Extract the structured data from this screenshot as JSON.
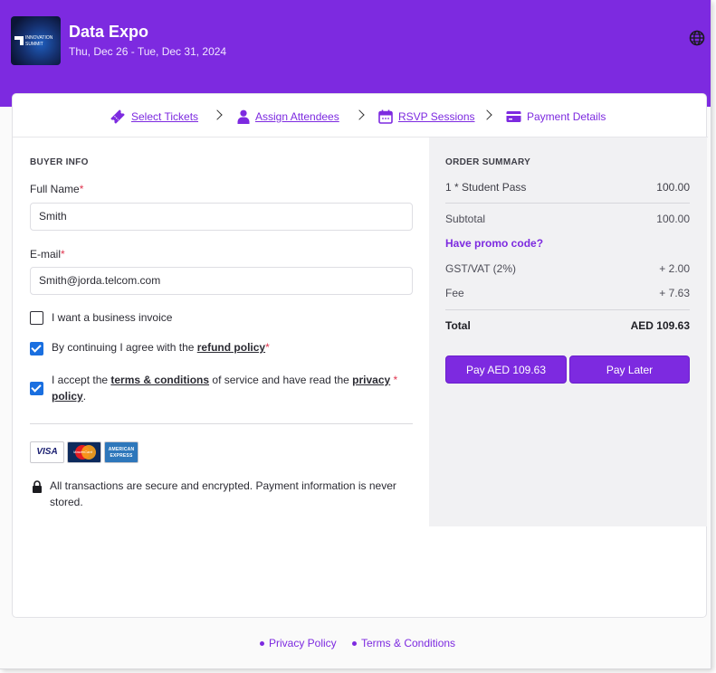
{
  "event": {
    "logo_line1": "INNOVATION",
    "logo_line2": "SUMMIT",
    "title": "Data Expo",
    "dates": "Thu, Dec 26 - Tue, Dec 31, 2024"
  },
  "header": {
    "globe_icon": "globe-icon"
  },
  "steps": [
    {
      "label": "Select Tickets",
      "icon": "ticket-icon"
    },
    {
      "label": "Assign Attendees",
      "icon": "person-icon"
    },
    {
      "label": "RSVP Sessions",
      "icon": "calendar-icon"
    },
    {
      "label": "Payment Details",
      "icon": "credit-card-icon"
    }
  ],
  "buyer": {
    "heading": "BUYER INFO",
    "full_name_label": "Full Name",
    "full_name_value": "Smith",
    "email_label": "E-mail",
    "email_value": "Smith@jorda.telcom.com",
    "required_mark": "*",
    "business_invoice": {
      "label": "I want a business invoice",
      "checked": false
    },
    "refund": {
      "prefix": "By continuing I agree with the ",
      "link": "refund policy",
      "checked": true
    },
    "terms": {
      "prefix": "I accept the ",
      "link1": "terms & conditions",
      "middle": " of service and have read the ",
      "link2a": "privacy",
      "link2b": "policy",
      "suffix": ".",
      "checked": true
    },
    "card_logos": {
      "visa": "VISA",
      "mastercard": "MasterCard",
      "amex_line1": "AMERICAN",
      "amex_line2": "EXPRESS"
    },
    "secure_note": "All transactions are secure and encrypted. Payment information is never stored."
  },
  "summary": {
    "heading": "ORDER SUMMARY",
    "item_label": "1 * Student Pass",
    "item_value": "100.00",
    "subtotal_label": "Subtotal",
    "subtotal_value": "100.00",
    "promo_label": "Have promo code?",
    "vat_label": "GST/VAT (2%)",
    "vat_value": "+ 2.00",
    "fee_label": "Fee",
    "fee_value": "+ 7.63",
    "total_label": "Total",
    "total_value": "AED 109.63",
    "pay_button": "Pay AED 109.63",
    "later_button": "Pay Later"
  },
  "footer": {
    "privacy": "Privacy Policy",
    "terms": "Terms & Conditions"
  },
  "colors": {
    "brand": "#7d2ae0",
    "checkbox": "#1a6fe0",
    "required": "#e0354f"
  }
}
